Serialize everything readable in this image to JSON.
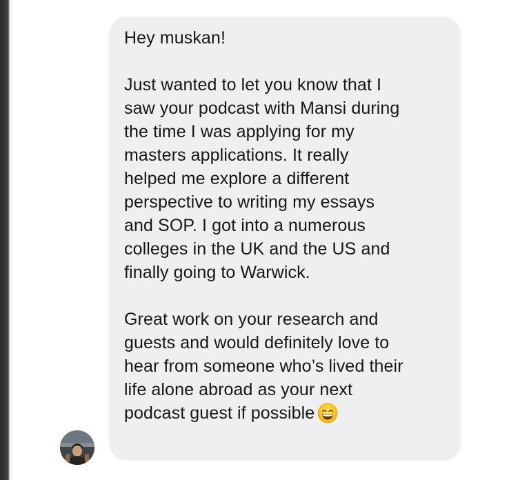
{
  "message": {
    "paragraphs": [
      "Hey muskan!",
      "Just wanted to let you know that I\nsaw your podcast with Mansi during\nthe time I was applying for my\nmasters applications. It really\nhelped me explore a different\nperspective to writing my essays\nand SOP. I got into a numerous\ncolleges in the UK and the US and\nfinally going to Warwick.",
      "Great work on your research and\nguests and would definitely love to\nhear from someone who’s lived their\nlife alone abroad as your next\npodcast guest if possible"
    ],
    "emoji": "grinning-face-with-smiling-eyes-icon"
  },
  "sender": {
    "avatar_icon": "profile-photo-avatar"
  },
  "colors": {
    "bubble": "#efeff1",
    "text": "#161616",
    "page": "#ffffff"
  }
}
